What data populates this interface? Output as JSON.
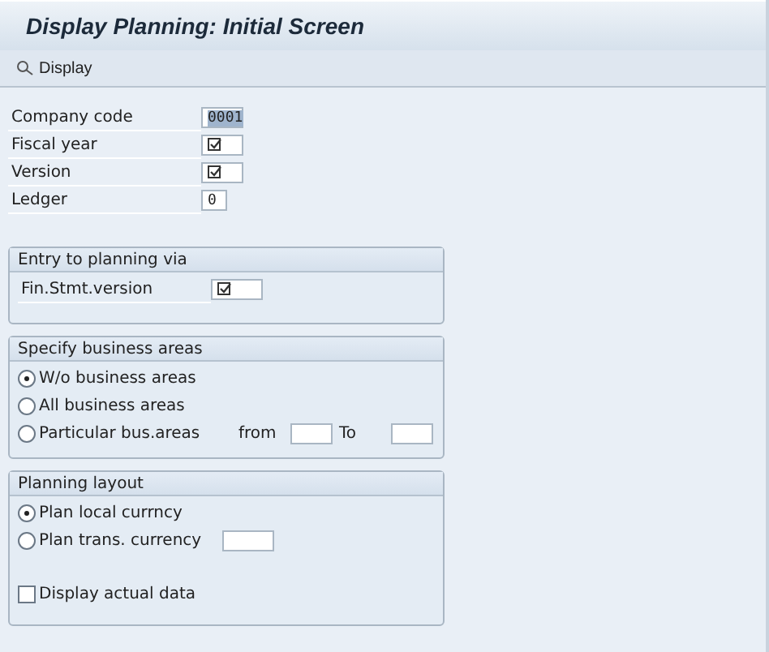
{
  "window": {
    "title": "Display Planning: Initial Screen"
  },
  "toolbar": {
    "buttons": [
      {
        "label": "Display"
      }
    ]
  },
  "fields": [
    {
      "label": "Company code",
      "kind": "value",
      "value": "0001",
      "selected": true
    },
    {
      "label": "Fiscal year",
      "kind": "required"
    },
    {
      "label": "Version",
      "kind": "required"
    },
    {
      "label": "Ledger",
      "kind": "value",
      "value": "0",
      "selected": false
    }
  ],
  "entry_group": {
    "title": "Entry to planning via",
    "fields": [
      {
        "label": "Fin.Stmt.version",
        "kind": "required"
      }
    ]
  },
  "business_areas": {
    "title": "Specify business areas",
    "options": [
      {
        "label": "W/o business areas",
        "selected": true
      },
      {
        "label": "All business areas",
        "selected": false
      },
      {
        "label": "Particular bus.areas",
        "selected": false,
        "range": {
          "from": "from",
          "to": "To"
        }
      }
    ]
  },
  "planning_layout": {
    "title": "Planning layout",
    "options": [
      {
        "label": "Plan local currncy",
        "selected": true
      },
      {
        "label": "Plan trans. currency",
        "selected": false,
        "input": true
      }
    ],
    "checkbox": {
      "label": "Display actual data",
      "checked": false
    }
  }
}
